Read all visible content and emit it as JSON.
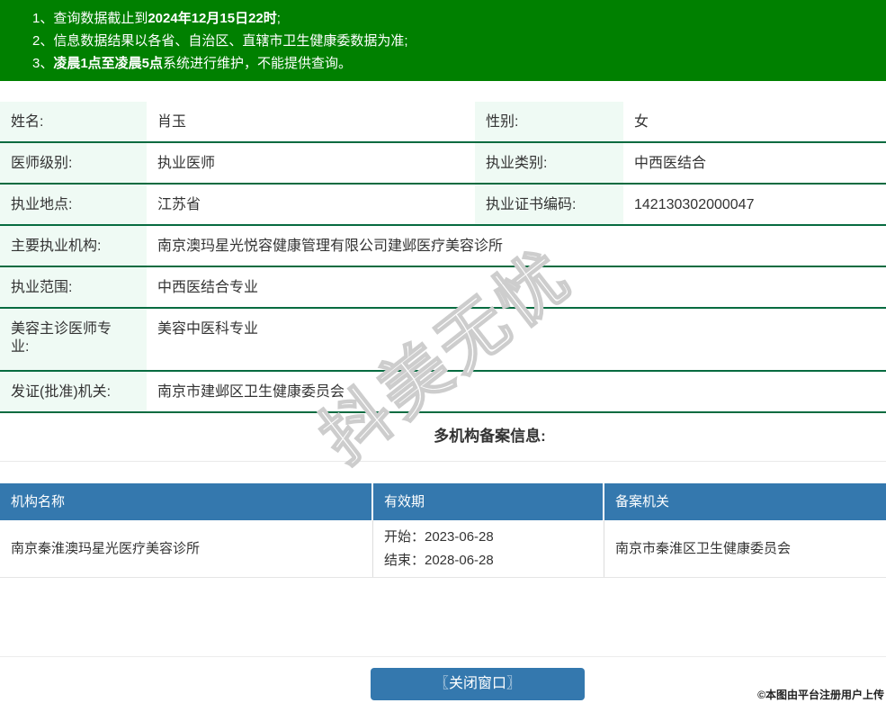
{
  "notice": {
    "items": [
      {
        "pre": "1、查询数据截止到",
        "bold": "2024年12月15日22时",
        "post": ";"
      },
      {
        "pre": "2、信息数据结果以各省、自治区、直辖市卫生健康委数据为准;",
        "bold": "",
        "post": ""
      },
      {
        "pre": "3、",
        "bold": "凌晨1点至凌晨5点",
        "post": "系统进行维护，不能提供查询。"
      }
    ]
  },
  "practitioner": {
    "paired_rows": [
      {
        "label1": "姓名:",
        "value1": "肖玉",
        "label2": "性别:",
        "value2": "女"
      },
      {
        "label1": "医师级别:",
        "value1": "执业医师",
        "label2": "执业类别:",
        "value2": "中西医结合"
      },
      {
        "label1": "执业地点:",
        "value1": "江苏省",
        "label2": "执业证书编码:",
        "value2": "142130302000047"
      }
    ],
    "full_rows": [
      {
        "label": "主要执业机构:",
        "value": "南京澳玛星光悦容健康管理有限公司建邺医疗美容诊所"
      },
      {
        "label": "执业范围:",
        "value": "中西医结合专业"
      },
      {
        "label": "美容主诊医师专业:",
        "value": "美容中医科专业"
      },
      {
        "label": "发证(批准)机关:",
        "value": "南京市建邺区卫生健康委员会"
      }
    ]
  },
  "multi_org": {
    "section_title": "多机构备案信息:",
    "table": {
      "headers": [
        "机构名称",
        "有效期",
        "备案机关"
      ],
      "rows": [
        {
          "name": "南京秦淮澳玛星光医疗美容诊所",
          "validity_start": "开始：2023-06-28",
          "validity_end": "结束：2028-06-28",
          "authority": "南京市秦淮区卫生健康委员会"
        }
      ]
    }
  },
  "actions": {
    "close_button_label": "〖关闭窗口〗"
  },
  "footer": {
    "copyright": "©本图由平台注册用户上传"
  },
  "watermark": {
    "text": "抖美无忧"
  },
  "colors": {
    "banner_green": "#008000",
    "label_cell_bg": "#effaf4",
    "row_border_green": "#076b40",
    "table_header_blue": "#3478ae",
    "button_blue": "#3478ae"
  }
}
